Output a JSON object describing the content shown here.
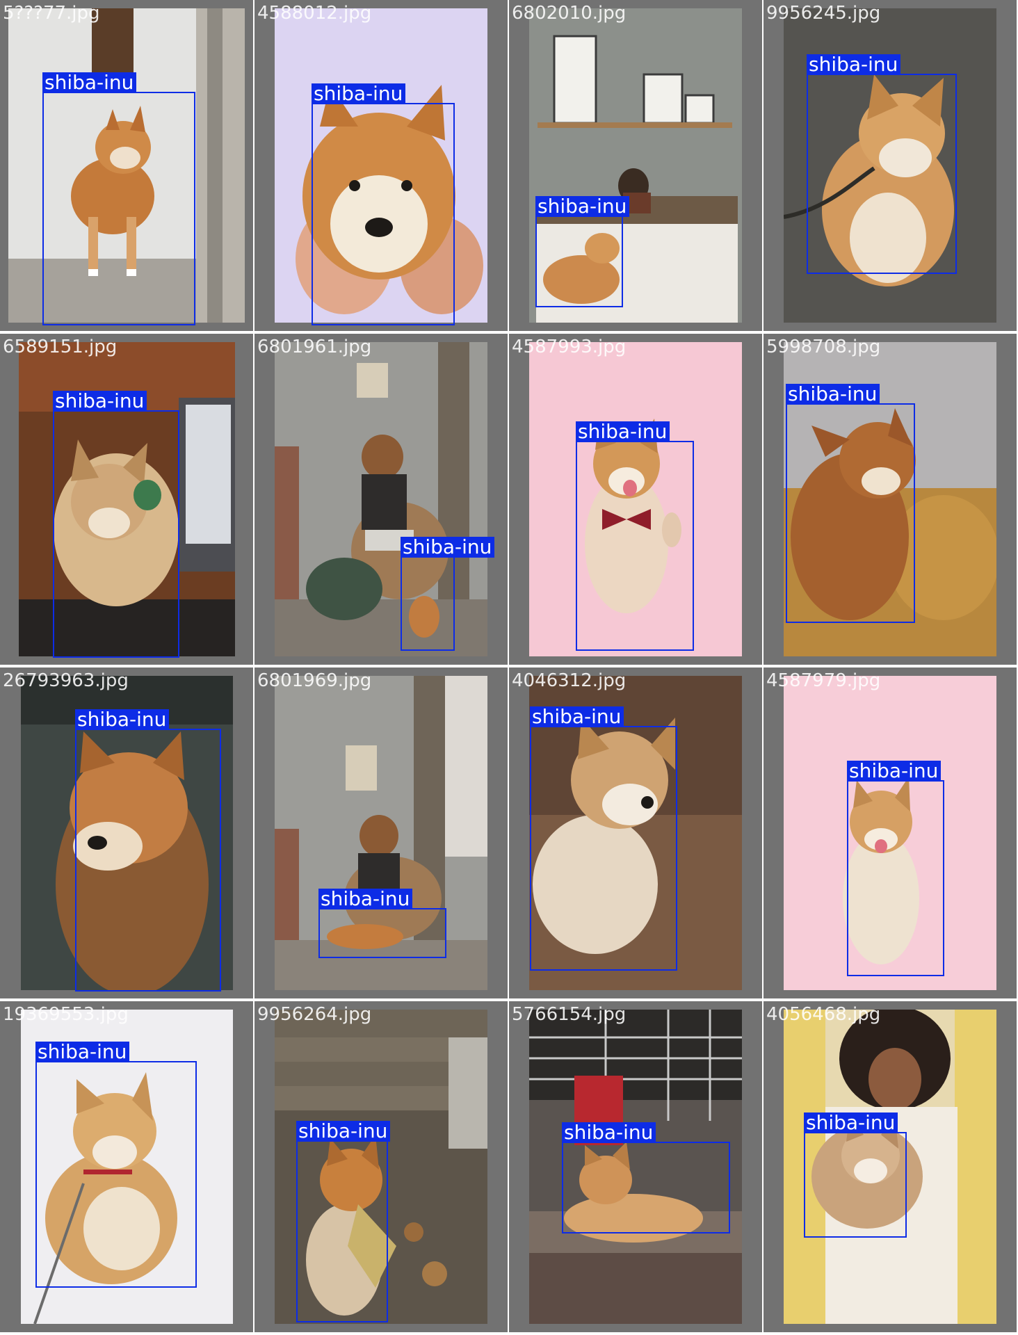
{
  "detection_class": "shiba-inu",
  "box_color": "#0d2ce6",
  "tiles": [
    {
      "filename": "5???77.jpg",
      "label": "shiba-inu",
      "bg": "#d9d9d6",
      "scene": "doorway"
    },
    {
      "filename": "4588012.jpg",
      "label": "shiba-inu",
      "bg": "#dcd4f2",
      "scene": "lavender-hands"
    },
    {
      "filename": "6802010.jpg",
      "label": "shiba-inu",
      "bg": "#8c908b",
      "scene": "bedroom"
    },
    {
      "filename": "9956245.jpg",
      "label": "shiba-inu",
      "bg": "#555450",
      "scene": "pavement"
    },
    {
      "filename": "6589151.jpg",
      "label": "shiba-inu",
      "bg": "#6b3d22",
      "scene": "laptop"
    },
    {
      "filename": "6801961.jpg",
      "label": "shiba-inu",
      "bg": "#9a9a96",
      "scene": "chair-woman"
    },
    {
      "filename": "4587993.jpg",
      "label": "shiba-inu",
      "bg": "#f6c8d4",
      "scene": "pink-bowtie"
    },
    {
      "filename": "5998708.jpg",
      "label": "shiba-inu",
      "bg": "#b5b3b4",
      "scene": "sofa"
    },
    {
      "filename": "26793963.jpg",
      "label": "shiba-inu",
      "bg": "#3f4744",
      "scene": "closeup"
    },
    {
      "filename": "6801969.jpg",
      "label": "shiba-inu",
      "bg": "#9c9c98",
      "scene": "chair-lying"
    },
    {
      "filename": "4046312.jpg",
      "label": "shiba-inu",
      "bg": "#5f4535",
      "scene": "wood-floor"
    },
    {
      "filename": "4587979.jpg",
      "label": "shiba-inu",
      "bg": "#f7cdd8",
      "scene": "pink-sitting"
    },
    {
      "filename": "19369553.jpg",
      "label": "shiba-inu",
      "bg": "#efeef1",
      "scene": "snow"
    },
    {
      "filename": "9956264.jpg",
      "label": "shiba-inu",
      "bg": "#5d554a",
      "scene": "leaves"
    },
    {
      "filename": "5766154.jpg",
      "label": "shiba-inu",
      "bg": "#5a5450",
      "scene": "street"
    },
    {
      "filename": "4056468.jpg",
      "label": "shiba-inu",
      "bg": "#e7d9b0",
      "scene": "armchair-woman"
    }
  ]
}
